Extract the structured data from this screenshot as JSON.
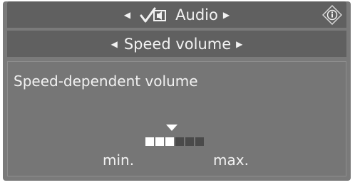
{
  "header": {
    "title": "Audio",
    "icon": "audio-settings-icon",
    "info_icon": "info-icon"
  },
  "subheader": {
    "title": "Speed volume"
  },
  "panel": {
    "title": "Speed-dependent volume",
    "level": {
      "current": 3,
      "total": 6
    },
    "min_label": "min.",
    "max_label": "max."
  },
  "colors": {
    "bar": "#606060",
    "panel": "#767676",
    "text": "#f2f2f2",
    "segment_on": "#ffffff",
    "segment_off": "#4a4a4a"
  }
}
